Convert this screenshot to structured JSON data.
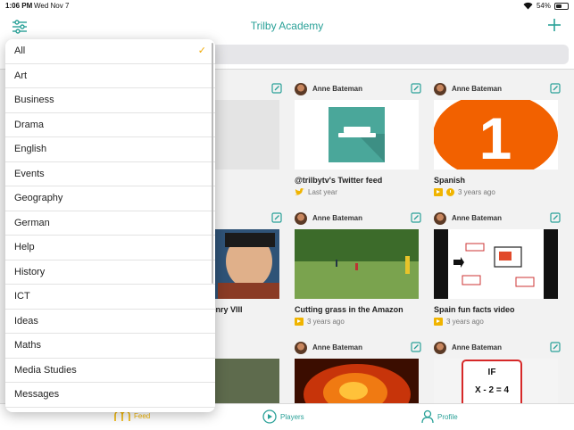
{
  "status": {
    "time": "1:06 PM",
    "date": "Wed Nov 7",
    "battery": "54%",
    "battery_level": 0.54
  },
  "nav": {
    "title": "Trilby Academy"
  },
  "filter_menu": {
    "selected": "All",
    "items": [
      "All",
      "Art",
      "Business",
      "Drama",
      "English",
      "Events",
      "Geography",
      "German",
      "Help",
      "History",
      "ICT",
      "Ideas",
      "Maths",
      "Media Studies",
      "Messages"
    ]
  },
  "cards": [
    {
      "author": "",
      "title": "",
      "meta": ""
    },
    {
      "author": "Anne Bateman",
      "title": "@trilbytv's Twitter feed",
      "meta": "Last year"
    },
    {
      "author": "Anne Bateman",
      "title": "Spanish",
      "meta": "3 years ago",
      "thumb_text": "1"
    },
    {
      "author": "",
      "title": "Henry VIII",
      "meta": ""
    },
    {
      "author": "Anne Bateman",
      "title": "Cutting grass in the Amazon",
      "meta": "3 years ago"
    },
    {
      "author": "Anne Bateman",
      "title": "Spain fun facts video",
      "meta": "3 years ago"
    },
    {
      "author": "",
      "title": "",
      "meta": ""
    },
    {
      "author": "Anne Bateman",
      "title": "",
      "meta": ""
    },
    {
      "author": "Anne Bateman",
      "title": "",
      "meta": "",
      "thumb_lines": [
        "IF",
        "X - 2 = 4"
      ]
    }
  ],
  "tabs": [
    {
      "label": "Feed"
    },
    {
      "label": "Players"
    },
    {
      "label": "Profile"
    }
  ],
  "colors": {
    "accent": "#2aa198",
    "highlight": "#f0b400",
    "spanish_orange": "#f26100"
  }
}
